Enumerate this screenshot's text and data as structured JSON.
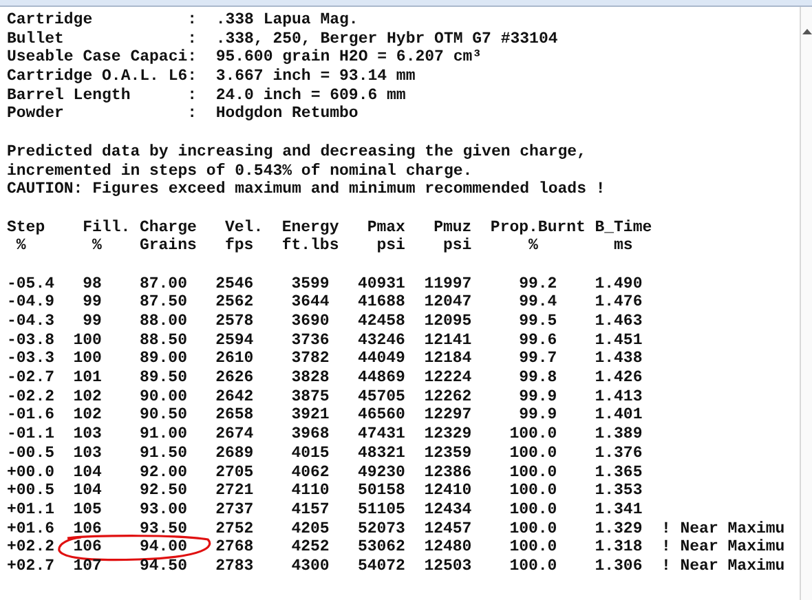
{
  "header_fields": [
    {
      "label": "Cartridge",
      "separator": ":",
      "value": ".338 Lapua Mag."
    },
    {
      "label": "Bullet",
      "separator": ":",
      "value": ".338, 250, Berger Hybr OTM G7 #33104"
    },
    {
      "label": "Useable Case Capaci",
      "separator": ":",
      "value": "95.600 grain H2O = 6.207 cm³"
    },
    {
      "label": "Cartridge O.A.L. L6",
      "separator": ":",
      "value": "3.667 inch = 93.14 mm"
    },
    {
      "label": "Barrel Length",
      "separator": ":",
      "value": "24.0 inch = 609.6 mm"
    },
    {
      "label": "Powder",
      "separator": ":",
      "value": "Hodgdon Retumbo"
    }
  ],
  "notes": [
    "Predicted data by increasing and decreasing the given charge,",
    "incremented in steps of 0.543% of nominal charge.",
    "CAUTION: Figures exceed maximum and minimum recommended loads !"
  ],
  "table": {
    "columns": [
      "Step",
      "Fill.",
      "Charge",
      "Vel.",
      "Energy",
      "Pmax",
      "Pmuz",
      "Prop.Burnt",
      "B_Time"
    ],
    "units": [
      "%",
      "%",
      "Grains",
      "fps",
      "ft.lbs",
      "psi",
      "psi",
      "%",
      "ms"
    ],
    "rows": [
      {
        "cells": [
          "-05.4",
          "98",
          "87.00",
          "2546",
          "3599",
          "40931",
          "11997",
          "99.2",
          "1.490"
        ],
        "circled": false
      },
      {
        "cells": [
          "-04.9",
          "99",
          "87.50",
          "2562",
          "3644",
          "41688",
          "12047",
          "99.4",
          "1.476"
        ],
        "circled": false
      },
      {
        "cells": [
          "-04.3",
          "99",
          "88.00",
          "2578",
          "3690",
          "42458",
          "12095",
          "99.5",
          "1.463"
        ],
        "circled": false
      },
      {
        "cells": [
          "-03.8",
          "100",
          "88.50",
          "2594",
          "3736",
          "43246",
          "12141",
          "99.6",
          "1.451"
        ],
        "circled": false
      },
      {
        "cells": [
          "-03.3",
          "100",
          "89.00",
          "2610",
          "3782",
          "44049",
          "12184",
          "99.7",
          "1.438"
        ],
        "circled": false
      },
      {
        "cells": [
          "-02.7",
          "101",
          "89.50",
          "2626",
          "3828",
          "44869",
          "12224",
          "99.8",
          "1.426"
        ],
        "circled": false
      },
      {
        "cells": [
          "-02.2",
          "102",
          "90.00",
          "2642",
          "3875",
          "45705",
          "12262",
          "99.9",
          "1.413"
        ],
        "circled": false
      },
      {
        "cells": [
          "-01.6",
          "102",
          "90.50",
          "2658",
          "3921",
          "46560",
          "12297",
          "99.9",
          "1.401"
        ],
        "circled": false
      },
      {
        "cells": [
          "-01.1",
          "103",
          "91.00",
          "2674",
          "3968",
          "47431",
          "12329",
          "100.0",
          "1.389"
        ],
        "circled": false
      },
      {
        "cells": [
          "-00.5",
          "103",
          "91.50",
          "2689",
          "4015",
          "48321",
          "12359",
          "100.0",
          "1.376"
        ],
        "circled": false
      },
      {
        "cells": [
          "+00.0",
          "104",
          "92.00",
          "2705",
          "4062",
          "49230",
          "12386",
          "100.0",
          "1.365"
        ],
        "circled": false
      },
      {
        "cells": [
          "+00.5",
          "104",
          "92.50",
          "2721",
          "4110",
          "50158",
          "12410",
          "100.0",
          "1.353"
        ],
        "circled": false
      },
      {
        "cells": [
          "+01.1",
          "105",
          "93.00",
          "2737",
          "4157",
          "51105",
          "12434",
          "100.0",
          "1.341"
        ],
        "circled": false
      },
      {
        "cells": [
          "+01.6",
          "106",
          "93.50",
          "2752",
          "4205",
          "52073",
          "12457",
          "100.0",
          "1.329"
        ],
        "note": "! Near Maximu",
        "circled": false
      },
      {
        "cells": [
          "+02.2",
          "106",
          "94.00",
          "2768",
          "4252",
          "53062",
          "12480",
          "100.0",
          "1.318"
        ],
        "note": "! Near Maximu",
        "circled": true
      },
      {
        "cells": [
          "+02.7",
          "107",
          "94.50",
          "2783",
          "4300",
          "54072",
          "12503",
          "100.0",
          "1.306"
        ],
        "note": "! Near Maximu",
        "circled": false
      }
    ]
  }
}
